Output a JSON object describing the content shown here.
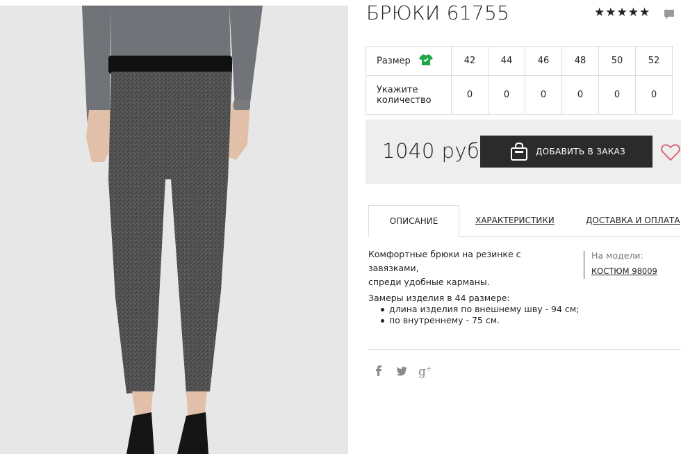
{
  "product": {
    "title": "БРЮКИ 61755",
    "rating": 5
  },
  "sizes": {
    "label": "Размер",
    "values": [
      "42",
      "44",
      "46",
      "48",
      "50",
      "52"
    ],
    "qty_label_line1": "Укажите",
    "qty_label_line2": "количество",
    "quantities": [
      "0",
      "0",
      "0",
      "0",
      "0",
      "0"
    ]
  },
  "price": {
    "value": "1040 руб",
    "add_button": "ДОБАВИТЬ В ЗАКАЗ"
  },
  "tabs": [
    {
      "label": "ОПИСАНИЕ",
      "active": true
    },
    {
      "label": "ХАРАКТЕРИСТИКИ",
      "active": false
    },
    {
      "label": "ДОСТАВКА И ОПЛАТА",
      "active": false
    }
  ],
  "description": {
    "line1": "Комфортные брюки на резинке с завязками,",
    "line2": "спреди удобные карманы.",
    "model_label": "На модели:",
    "model_link": "КОСТЮМ 98009",
    "measure_title": "Замеры изделия в 44 размере:",
    "measures": [
      "длина изделия по внешнему шву - 94 см;",
      "по внутреннему - 75 см."
    ]
  },
  "colors": {
    "button_bg": "#2b2b2b",
    "panel_bg": "#eeeeee",
    "heart": "#d96b7c",
    "shirt_icon": "#1fa845"
  },
  "icons": [
    "star-icon",
    "comment-icon",
    "shirt-icon",
    "bag-icon",
    "heart-icon",
    "facebook-icon",
    "twitter-icon",
    "google-plus-icon"
  ]
}
